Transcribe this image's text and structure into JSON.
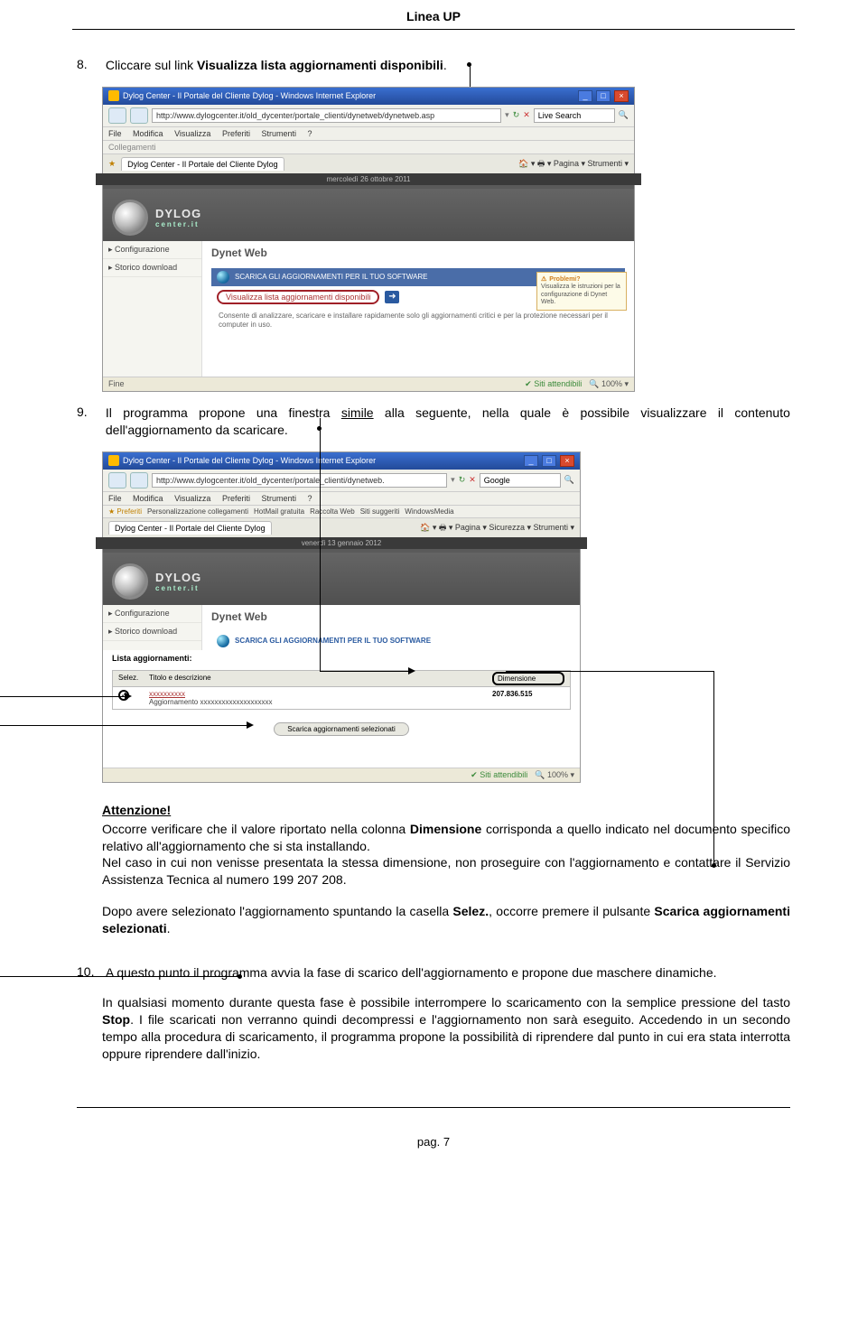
{
  "header": {
    "title": "Linea UP"
  },
  "item8": {
    "num": "8.",
    "pre": "Cliccare sul link ",
    "link": "Visualizza lista aggiornamenti disponibili",
    "post": "."
  },
  "shot1": {
    "title": "Dylog Center - Il Portale del Cliente Dylog - Windows Internet Explorer",
    "url": "http://www.dylogcenter.it/old_dycenter/portale_clienti/dynetweb/dynetweb.asp",
    "search": "Live Search",
    "menu": {
      "file": "File",
      "modifica": "Modifica",
      "visualizza": "Visualizza",
      "preferiti": "Preferiti",
      "strumenti": "Strumenti",
      "q": "?"
    },
    "collegamenti": "Collegamenti",
    "tab": "Dylog Center - Il Portale del Cliente Dylog",
    "tools": "Pagina ▾   Strumenti ▾",
    "date": "mercoledì 26 ottobre 2011",
    "logo": "DYLOG",
    "logosub": "center.it",
    "side1": "Configurazione",
    "side2": "Storico download",
    "heading": "Dynet Web",
    "bluebar": "SCARICA GLI AGGIORNAMENTI PER IL TUO SOFTWARE",
    "redlink": "Visualizza lista aggiornamenti disponibili",
    "helptext": "Consente di analizzare, scaricare e installare rapidamente solo gli aggiornamenti critici e per la protezione necessari per il computer in uso.",
    "info_title": "Problemi?",
    "info_body": "Visualizza le istruzioni per la configurazione di Dynet Web.",
    "status_fine": "Fine",
    "status_trusted": "Siti attendibili",
    "status_zoom": "100%  ▾"
  },
  "item9": {
    "num": "9.",
    "pre": "Il programma propone una finestra ",
    "simile": "simile",
    "post": " alla seguente, nella quale è possibile visualizzare il contenuto dell'aggiornamento da scaricare."
  },
  "shot2": {
    "title": "Dylog Center - Il Portale del Cliente Dylog - Windows Internet Explorer",
    "url": "http://www.dylogcenter.it/old_dycenter/portale_clienti/dynetweb.",
    "search": "Google",
    "fav_label": "Preferiti",
    "fav1": "Personalizzazione collegamenti",
    "fav2": "HotMail gratuita",
    "fav3": "Raccolta Web",
    "fav4": "Siti suggeriti",
    "fav5": "WindowsMedia",
    "tab": "Dylog Center - Il Portale del Cliente Dylog",
    "tools": "Pagina ▾  Sicurezza ▾  Strumenti ▾",
    "date": "venerdì 13 gennaio 2012",
    "heading": "Dynet Web",
    "bluebar": "SCARICA GLI AGGIORNAMENTI PER IL TUO SOFTWARE",
    "list_title": "Lista aggiornamenti:",
    "col_selez": "Selez.",
    "col_titolo": "Titolo e descrizione",
    "col_dim": "Dimensione",
    "row_title": "xxxxxxxxxx",
    "row_desc": "Aggiornamento xxxxxxxxxxxxxxxxxxxx",
    "row_dim": "207.836.515",
    "btn": "Scarica aggiornamenti selezionati",
    "status_trusted": "Siti attendibili",
    "status_zoom": "100%  ▾"
  },
  "attn": {
    "title": "Attenzione!",
    "p1a": "Occorre verificare che il valore riportato nella colonna ",
    "p1b": "Dimensione",
    "p1c": " corrisponda a quello indicato nel documento specifico relativo all'aggiornamento che si sta installando.",
    "p2": "Nel caso in cui non venisse presentata la stessa dimensione, non proseguire con l'aggiornamento e contattare il Servizio Assistenza Tecnica al numero 199 207 208."
  },
  "after": {
    "pre": "Dopo avere selezionato l'aggiornamento spuntando la casella ",
    "selez": "Selez.",
    "mid": ", occorre premere il pulsante ",
    "btn": "Scarica aggiornamenti selezionati",
    "post": "."
  },
  "item10": {
    "num": "10.",
    "p1": "A questo punto il programma avvia la fase di scarico dell'aggiornamento e propone due maschere dinamiche.",
    "p2a": "In qualsiasi momento durante questa fase è possibile interrompere lo scaricamento con la semplice pressione del tasto ",
    "p2b": "Stop",
    "p2c": ". I file scaricati non verranno quindi decompressi e l'aggiornamento non sarà eseguito. Accedendo in un secondo tempo alla procedura di scaricamento, il programma propone la possibilità di riprendere dal punto in cui era stata interrotta oppure riprendere dall'inizio."
  },
  "footer": {
    "page": "pag. 7"
  }
}
